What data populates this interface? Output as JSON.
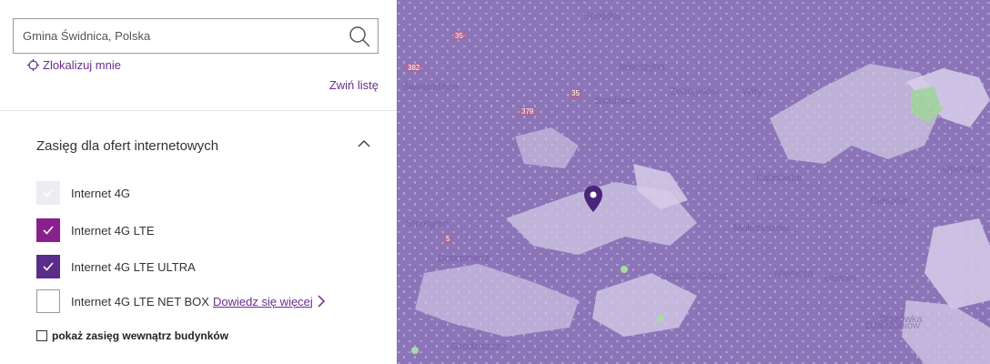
{
  "search": {
    "value": "Gmina Świdnica, Polska",
    "placeholder": "Gmina Świdnica, Polska"
  },
  "locate_label": "Zlokalizuj mnie",
  "collapse_label": "Zwiń listę",
  "section": {
    "title": "Zasięg dla ofert internetowych"
  },
  "options": [
    {
      "label": "Internet 4G",
      "state": "dimmed"
    },
    {
      "label": "Internet 4G LTE",
      "state": "checked"
    },
    {
      "label": "Internet 4G LTE ULTRA",
      "state": "checked"
    },
    {
      "label": "Internet 4G LTE NET BOX",
      "state": "unchecked",
      "link": "Dowiedz się więcej"
    }
  ],
  "indoor_label": "pokaż zasięg wewnątrz budynków",
  "colors": {
    "accent": "#6b2c91",
    "check_lte": "#8a1f8e",
    "check_ultra": "#5b2d8a",
    "map_coverage": "#8b75b8"
  },
  "map": {
    "labels": [
      "Świebodzice",
      "Świdnica",
      "Dzierżoniów",
      "Olszówka",
      "Kalinówka",
      "Sobótka",
      "Jaworzyna",
      "Zebrzydów",
      "Mokrzeszów",
      "Opoczka",
      "Lutomia Górna",
      "Niemcza",
      "Cieszów",
      "Wiry",
      "Udanin",
      "Strzegom",
      "Dobromierz",
      "Grodziszcze"
    ],
    "roads": [
      "35",
      "382",
      "35",
      "379",
      "5"
    ]
  }
}
